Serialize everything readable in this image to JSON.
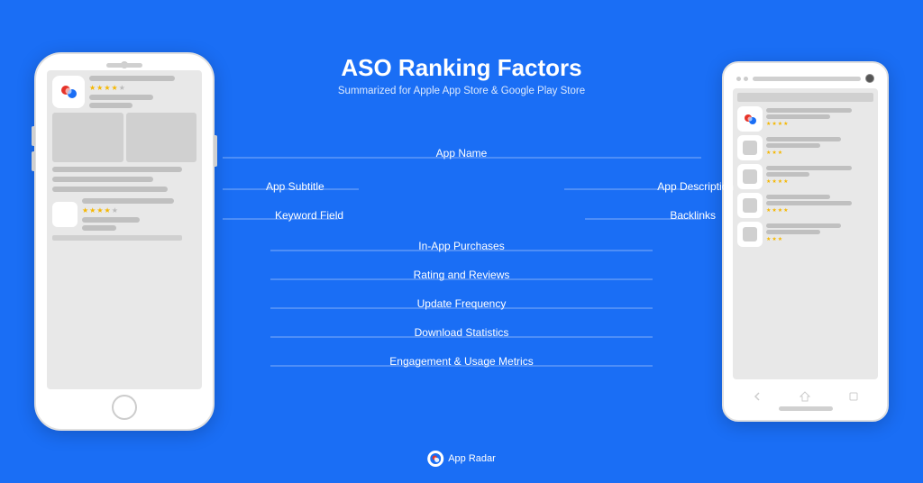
{
  "page": {
    "background_color": "#1a6ef5",
    "title": "ASO Ranking Factors",
    "subtitle": "Summarized for Apple App Store & Google Play Store"
  },
  "labels": {
    "app_name": "App Name",
    "app_subtitle": "App Subtitle",
    "keyword_field": "Keyword Field",
    "app_description": "App Description",
    "backlinks": "Backlinks",
    "in_app_purchases": "In-App Purchases",
    "rating_reviews": "Rating and Reviews",
    "update_frequency": "Update Frequency",
    "download_statistics": "Download Statistics",
    "engagement": "Engagement & Usage Metrics"
  },
  "branding": {
    "logo_name": "App Radar",
    "accent_color": "#1a6ef5"
  }
}
